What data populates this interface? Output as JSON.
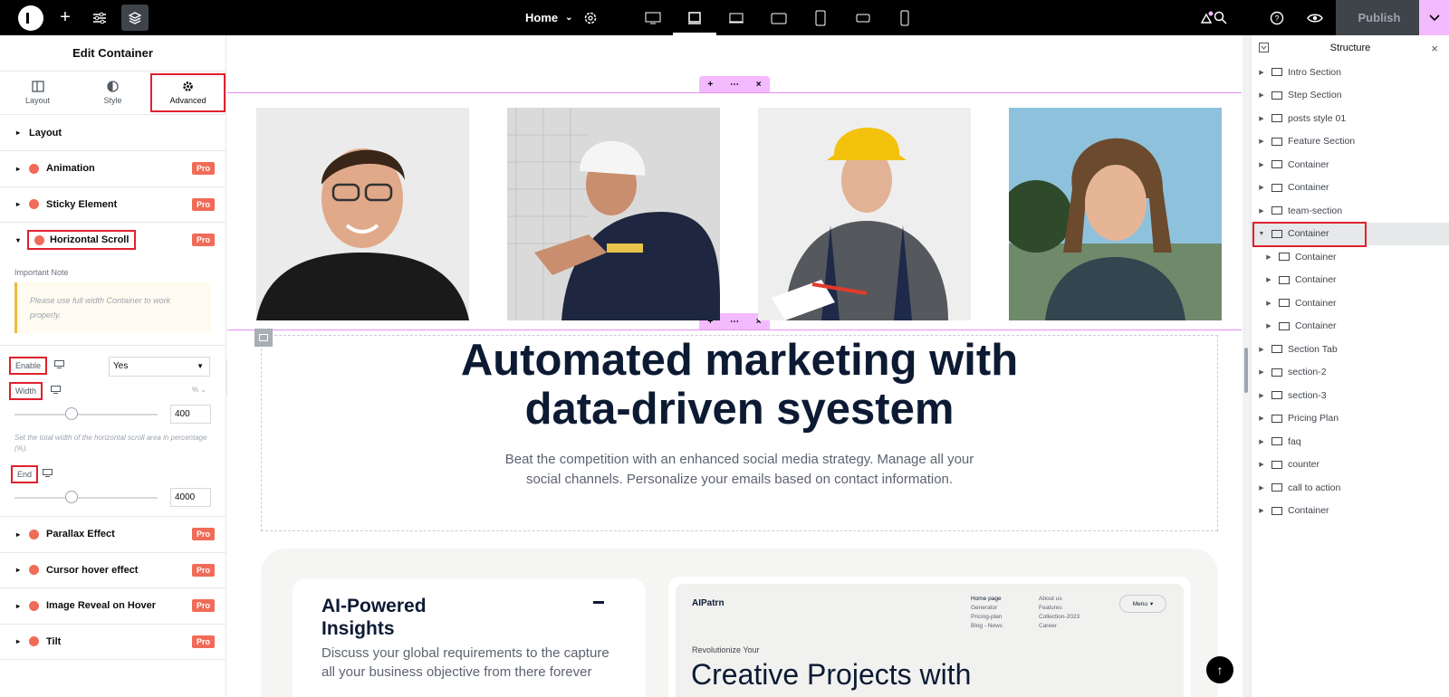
{
  "topbar": {
    "page_name": "Home",
    "publish_label": "Publish"
  },
  "left_panel": {
    "title": "Edit Container",
    "tabs": [
      {
        "label": "Layout",
        "icon": "layout-icon"
      },
      {
        "label": "Style",
        "icon": "contrast-icon"
      },
      {
        "label": "Advanced",
        "icon": "gear-icon"
      }
    ],
    "sections": {
      "layout": "Layout",
      "animation": "Animation",
      "sticky": "Sticky Element",
      "hscroll": "Horizontal Scroll",
      "parallax": "Parallax Effect",
      "cursor": "Cursor hover effect",
      "reveal": "Image Reveal on Hover",
      "tilt": "Tilt"
    },
    "pro_label": "Pro",
    "note_label": "Important Note",
    "note_text": "Please use full width Container to work properly.",
    "enable_label": "Enable",
    "enable_value": "Yes",
    "width_label": "Width",
    "width_unit": "%",
    "width_value": "400",
    "width_fraction": 0.4,
    "width_help": "Set the total width of the horizontal scroll area in percentage (%).",
    "end_label": "End",
    "end_value": "4000",
    "end_fraction": 0.4
  },
  "canvas": {
    "hero_title_line1": "Automated marketing with",
    "hero_title_line2": "data-driven syestem",
    "hero_sub_line1": "Beat the competition with an enhanced social media strategy. Manage all your",
    "hero_sub_line2": "social channels. Personalize your emails based on contact information.",
    "feature_title_line1": "AI-Powered",
    "feature_title_line2": "Insights",
    "feature_desc": "Discuss your global requirements to the capture all your business objective from there forever",
    "preview": {
      "brand": "AIPatrn",
      "nav_col1": [
        "Home page",
        "Generator",
        "Pricing-plan",
        "Blog - News"
      ],
      "nav_col2": [
        "About us",
        "Features",
        "Collection-2023",
        "Career"
      ],
      "menu_label": "Menu",
      "eyebrow": "Revolutionize Your",
      "headline": "Creative Projects with"
    }
  },
  "structure": {
    "title": "Structure",
    "items": [
      {
        "label": "Intro Section",
        "level": 0
      },
      {
        "label": "Step Section",
        "level": 0
      },
      {
        "label": "posts style 01",
        "level": 0
      },
      {
        "label": "Feature Section",
        "level": 0
      },
      {
        "label": "Container",
        "level": 0
      },
      {
        "label": "Container",
        "level": 0
      },
      {
        "label": "team-section",
        "level": 0
      },
      {
        "label": "Container",
        "level": 0,
        "selected": true
      },
      {
        "label": "Container",
        "level": 1
      },
      {
        "label": "Container",
        "level": 1
      },
      {
        "label": "Container",
        "level": 1
      },
      {
        "label": "Container",
        "level": 1
      },
      {
        "label": "Section Tab",
        "level": 0
      },
      {
        "label": "section-2",
        "level": 0
      },
      {
        "label": "section-3",
        "level": 0
      },
      {
        "label": "Pricing Plan",
        "level": 0
      },
      {
        "label": "faq",
        "level": 0
      },
      {
        "label": "counter",
        "level": 0
      },
      {
        "label": "call to action",
        "level": 0
      },
      {
        "label": "Container",
        "level": 0
      }
    ]
  },
  "colors": {
    "accent_pink": "#f3bafd",
    "pro_badge": "#f06b58",
    "highlight_red": "#e0202e"
  }
}
